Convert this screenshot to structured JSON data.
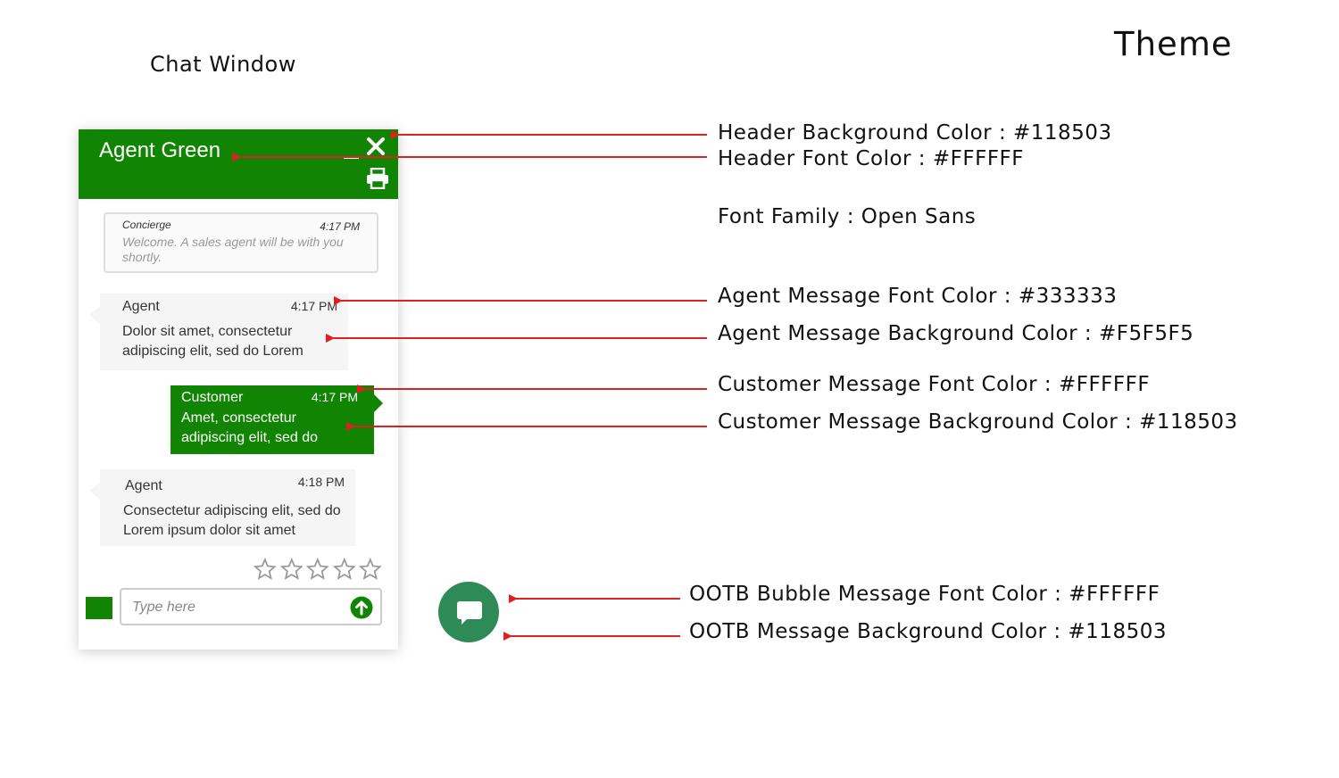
{
  "page": {
    "section_title": "Chat Window",
    "theme_title": "Theme"
  },
  "chat": {
    "header": {
      "agent_name": "Agent Green",
      "minimize_icon": "minimize-icon",
      "close_icon": "close-icon",
      "print_icon": "print-icon"
    },
    "concierge": {
      "name": "Concierge",
      "time": "4:17 PM",
      "text": "Welcome. A sales agent will be with you shortly."
    },
    "messages": [
      {
        "sender": "Agent",
        "time": "4:17 PM",
        "text": "Dolor sit amet, consectetur adipiscing elit, sed do Lorem"
      },
      {
        "sender": "Customer",
        "time": "4:17 PM",
        "text": "Amet, consectetur adipiscing elit, sed do"
      },
      {
        "sender": "Agent",
        "time": "4:18 PM",
        "text": "Consectetur adipiscing elit, sed do Lorem ipsum dolor sit amet"
      }
    ],
    "rating": {
      "max_stars": 5,
      "selected": 0
    },
    "input": {
      "placeholder": "Type here",
      "value": ""
    }
  },
  "annotations": [
    "Header Background Color : #118503",
    "Header Font Color : #FFFFFF",
    "Font Family : Open Sans",
    "Agent Message Font Color : #333333",
    "Agent Message Background Color : #F5F5F5",
    "Customer Message Font Color : #FFFFFF",
    "Customer Message Background Color : #118503",
    "OOTB Bubble Message Font Color : #FFFFFF",
    "OOTB Message Background Color : #118503"
  ],
  "colors": {
    "header_bg": "#118503",
    "header_font": "#FFFFFF",
    "agent_font": "#333333",
    "agent_bg": "#F5F5F5",
    "customer_font": "#FFFFFF",
    "customer_bg": "#118503",
    "annotation_arrow": "#E02020"
  }
}
